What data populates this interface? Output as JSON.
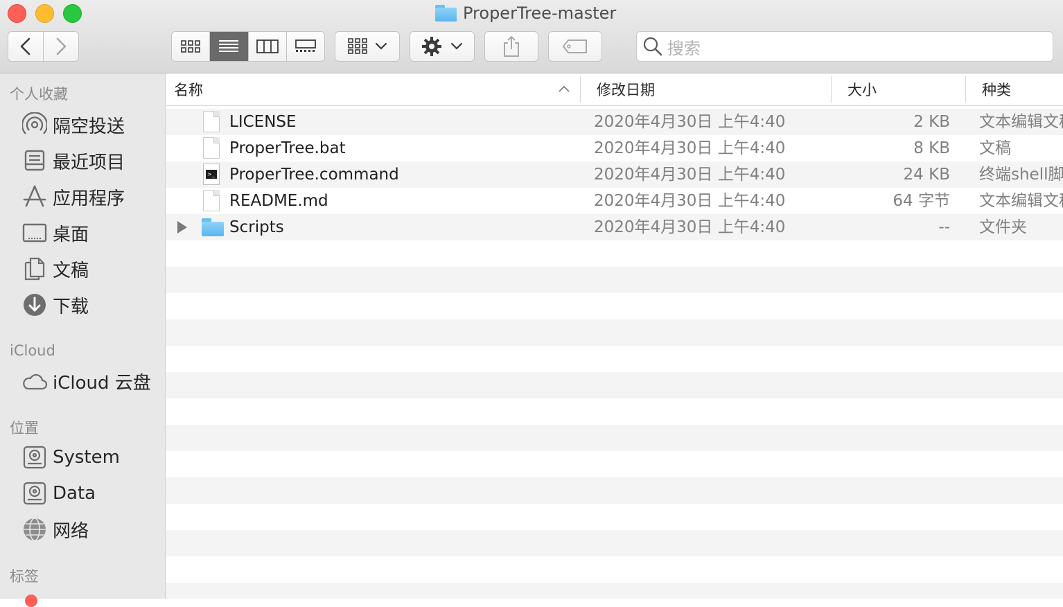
{
  "window": {
    "title": "ProperTree-master"
  },
  "toolbar": {
    "search_placeholder": "搜索"
  },
  "sidebar": {
    "favorites_header": "个人收藏",
    "favorites": [
      {
        "label": "隔空投送",
        "icon": "airdrop-icon"
      },
      {
        "label": "最近项目",
        "icon": "recents-icon"
      },
      {
        "label": "应用程序",
        "icon": "applications-icon"
      },
      {
        "label": "桌面",
        "icon": "desktop-icon"
      },
      {
        "label": "文稿",
        "icon": "documents-icon"
      },
      {
        "label": "下载",
        "icon": "downloads-icon"
      }
    ],
    "icloud_header": "iCloud",
    "icloud": [
      {
        "label": "iCloud 云盘",
        "icon": "cloud-icon"
      }
    ],
    "locations_header": "位置",
    "locations": [
      {
        "label": "System",
        "icon": "hard-drive-icon"
      },
      {
        "label": "Data",
        "icon": "hard-drive-icon"
      },
      {
        "label": "网络",
        "icon": "network-globe-icon"
      }
    ],
    "tags_header": "标签"
  },
  "columns": {
    "name": "名称",
    "date": "修改日期",
    "size": "大小",
    "kind": "种类"
  },
  "files": [
    {
      "name": "LICENSE",
      "date": "2020年4月30日 上午4:40",
      "size": "2 KB",
      "kind": "文本编辑文稿",
      "icon": "document-icon"
    },
    {
      "name": "ProperTree.bat",
      "date": "2020年4月30日 上午4:40",
      "size": "8 KB",
      "kind": "文稿",
      "icon": "document-icon"
    },
    {
      "name": "ProperTree.command",
      "date": "2020年4月30日 上午4:40",
      "size": "24 KB",
      "kind": "终端shell脚本",
      "icon": "terminal-script-icon"
    },
    {
      "name": "README.md",
      "date": "2020年4月30日 上午4:40",
      "size": "64 字节",
      "kind": "文本编辑文稿",
      "icon": "document-icon"
    },
    {
      "name": "Scripts",
      "date": "2020年4月30日 上午4:40",
      "size": "--",
      "kind": "文件夹",
      "icon": "folder-icon"
    }
  ],
  "colors": {
    "folder": "#5bb5ee",
    "sidebar_bg": "#e8e8e8",
    "row_alt": "#f4f4f4"
  }
}
